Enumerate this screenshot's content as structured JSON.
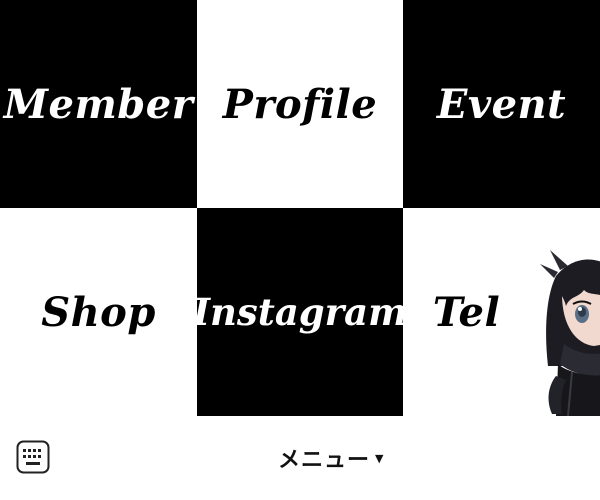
{
  "rich_menu": {
    "tiles": [
      {
        "label": "Member",
        "theme": "black"
      },
      {
        "label": "Profile",
        "theme": "white"
      },
      {
        "label": "Event",
        "theme": "black"
      },
      {
        "label": "Shop",
        "theme": "white"
      },
      {
        "label": "Instagram",
        "theme": "black"
      },
      {
        "label": "Tel",
        "theme": "white"
      }
    ]
  },
  "menu_bar": {
    "keyboard_icon": "keyboard-icon",
    "menu_label": "メニュー",
    "caret": "▼",
    "caret_icon": "caret-down-icon"
  },
  "colors": {
    "black_tile": "#000000",
    "white_tile": "#ffffff",
    "menu_text": "#111111"
  }
}
